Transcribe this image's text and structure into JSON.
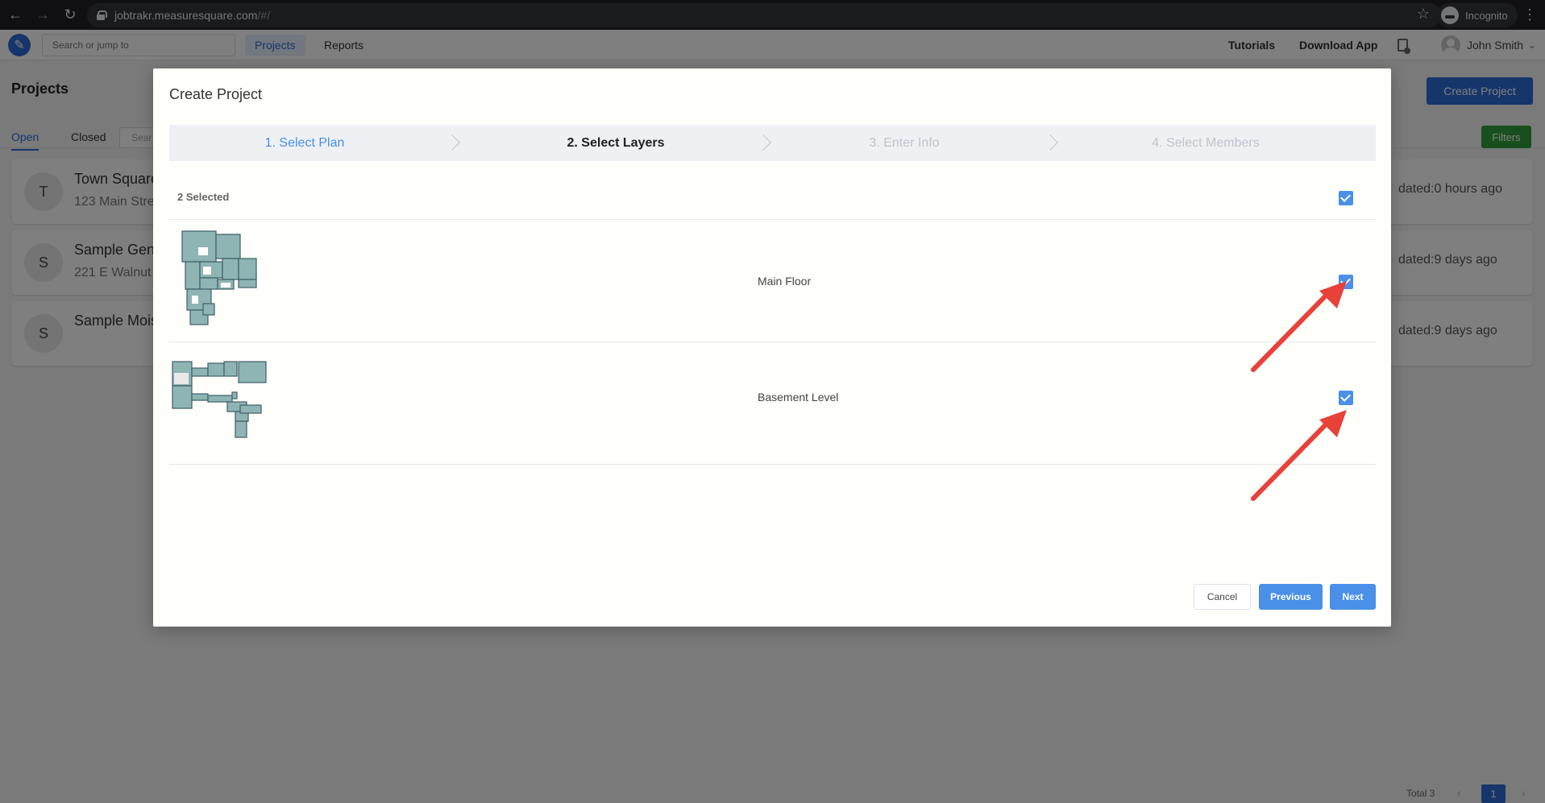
{
  "browser": {
    "url_host": "jobtrakr.measuresquare.com",
    "url_path": "/#/",
    "incognito_label": "Incognito"
  },
  "appbar": {
    "search_placeholder": "Search or jump to",
    "nav": [
      "Projects",
      "Reports"
    ],
    "tutorials": "Tutorials",
    "download_app": "Download App",
    "user_name": "John Smith"
  },
  "page": {
    "title": "Projects",
    "create_button": "Create Project",
    "tabs": [
      "Open",
      "Closed"
    ],
    "search_placeholder": "Sear",
    "filters_button": "Filters",
    "projects": [
      {
        "initial": "T",
        "name": "Town Square",
        "address": "123 Main Stre",
        "updated": "dated:0 hours ago"
      },
      {
        "initial": "S",
        "name": "Sample Gen",
        "address": "221 E Walnut",
        "updated": "dated:9 days ago"
      },
      {
        "initial": "S",
        "name": "Sample Mois",
        "address": "",
        "updated": "dated:9 days ago"
      }
    ],
    "pager": {
      "total": "Total 3",
      "current": "1"
    }
  },
  "modal": {
    "title": "Create Project",
    "steps": [
      {
        "label": "1. Select Plan",
        "state": "done"
      },
      {
        "label": "2. Select Layers",
        "state": "current"
      },
      {
        "label": "3. Enter Info",
        "state": "pending"
      },
      {
        "label": "4. Select Members",
        "state": "pending"
      }
    ],
    "selected_count": "2 Selected",
    "layers": [
      {
        "name": "Main Floor",
        "checked": true
      },
      {
        "name": "Basement Level",
        "checked": true
      }
    ],
    "buttons": {
      "cancel": "Cancel",
      "previous": "Previous",
      "next": "Next"
    }
  },
  "colors": {
    "accent": "#4a8fe8",
    "brand": "#2d6bd6",
    "filters_green": "#2f9e3a",
    "arrow_red": "#e8413a"
  },
  "icons": [
    "back-icon",
    "forward-icon",
    "reload-icon",
    "lock-icon",
    "star-icon",
    "incognito-icon",
    "menu-icon",
    "logo-icon",
    "document-icon",
    "avatar",
    "chevron-down-icon",
    "check-icon",
    "floor-plan-thumbnail",
    "annotation-arrow"
  ]
}
